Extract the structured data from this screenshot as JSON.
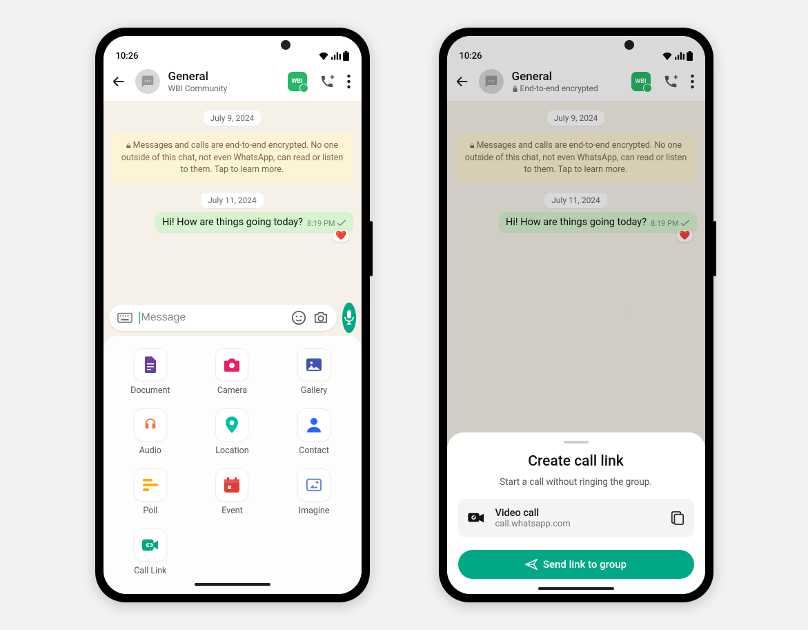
{
  "status_time": "10:26",
  "chat": {
    "name": "General",
    "subtitle_left": "WBI Community",
    "subtitle_right": "End-to-end encrypted",
    "date1": "July 9, 2024",
    "encryption_text": "Messages and calls are end-to-end encrypted. No one outside of this chat, not even WhatsApp, can read or listen to them. Tap to learn more.",
    "date2": "July 11, 2024",
    "message_text": "Hi! How are things going today?",
    "message_time": "8:19 PM",
    "reaction": "❤️"
  },
  "input_placeholder": "Message",
  "attachments": [
    {
      "label": "Document",
      "color": "#6b3fa0",
      "icon": "doc"
    },
    {
      "label": "Camera",
      "color": "#e91e63",
      "icon": "camera"
    },
    {
      "label": "Gallery",
      "color": "#3f51b5",
      "icon": "gallery"
    },
    {
      "label": "Audio",
      "color": "#ff6d33",
      "icon": "audio"
    },
    {
      "label": "Location",
      "color": "#00bfa5",
      "icon": "location"
    },
    {
      "label": "Contact",
      "color": "#2962ff",
      "icon": "contact"
    },
    {
      "label": "Poll",
      "color": "#ffab00",
      "icon": "poll"
    },
    {
      "label": "Event",
      "color": "#e53935",
      "icon": "event"
    },
    {
      "label": "Imagine",
      "color": "#5c7bd9",
      "icon": "imagine"
    },
    {
      "label": "Call Link",
      "color": "#00a884",
      "icon": "calllink"
    }
  ],
  "partial_attachments": [
    {
      "label": "Document",
      "color": "#6b3fa0",
      "icon": "doc"
    },
    {
      "label": "Camera",
      "color": "#e91e63",
      "icon": "camera"
    },
    {
      "label": "Gallery",
      "color": "#3f51b5",
      "icon": "gallery"
    },
    {
      "label": "Audio",
      "color": "#ff6d33",
      "icon": "audio"
    },
    {
      "label": "Location",
      "color": "#00bfa5",
      "icon": "location"
    },
    {
      "label": "Contact",
      "color": "#2962ff",
      "icon": "contact"
    }
  ],
  "call_sheet": {
    "title": "Create call link",
    "subtitle": "Start a call without ringing the group.",
    "type": "Video call",
    "url": "call.whatsapp.com",
    "button": "Send link to group"
  },
  "badge_text": "WBI"
}
